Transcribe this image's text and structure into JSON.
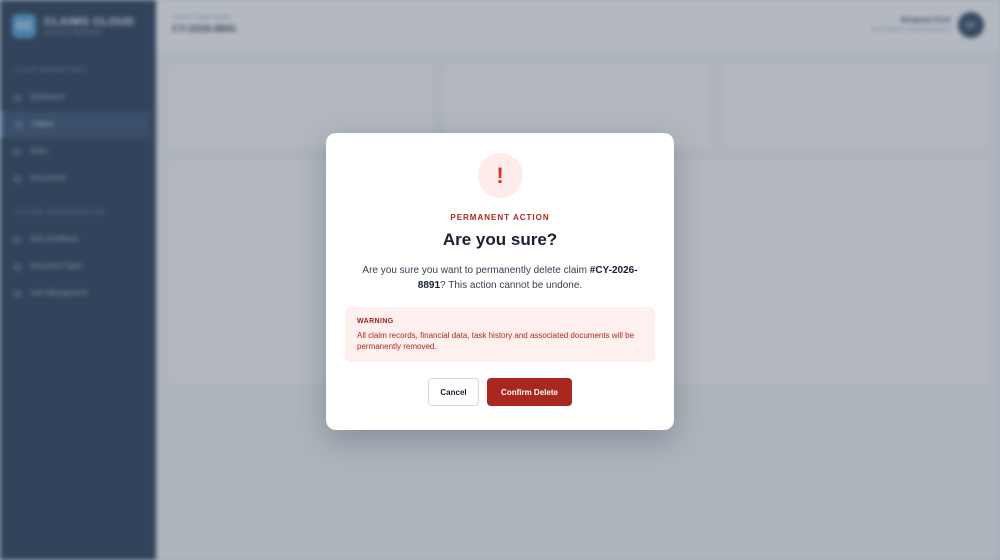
{
  "sidebar": {
    "brand": {
      "name": "CLAIMS CLOUD",
      "subtitle": "Insurance Operations",
      "logo_glyph": "CC"
    },
    "section_1": "CLAIM OPERATIONS",
    "section_2": "SYSTEM CONFIGURATION",
    "items_1": [
      {
        "label": "Dashboard",
        "icon": "home-icon"
      },
      {
        "label": "Claims",
        "icon": "folder-icon",
        "active": true
      },
      {
        "label": "Tasks",
        "icon": "check-icon"
      },
      {
        "label": "Documents",
        "icon": "document-icon"
      }
    ],
    "items_2": [
      {
        "label": "Task Workflows",
        "icon": "workflow-icon"
      },
      {
        "label": "Document Types",
        "icon": "doctype-icon"
      },
      {
        "label": "User Management",
        "icon": "users-icon"
      }
    ]
  },
  "header": {
    "breadcrumb": "Claims / Claim Details",
    "claim_id": "CY-2026-8891",
    "user_name": "Benjamin Ford",
    "user_role": "Senior Adjuster, Claims Department",
    "user_initials": "BF"
  },
  "modal": {
    "icon": "exclamation-icon",
    "icon_glyph": "!",
    "kicker": "PERMANENT ACTION",
    "title": "Are you sure?",
    "desc_prefix": "Are you sure you want to permanently delete claim ",
    "desc_claim": "#CY-2026-8891",
    "desc_suffix": "? This action cannot be undone.",
    "warning_title": "WARNING",
    "warning_text": "All claim records, financial data, task history and associated documents will be permanently removed.",
    "cancel_label": "Cancel",
    "confirm_label": "Confirm Delete"
  },
  "colors": {
    "danger": "#a9271e",
    "danger_soft": "#fdf0ef",
    "sidebar_bg": "#0f2744"
  }
}
